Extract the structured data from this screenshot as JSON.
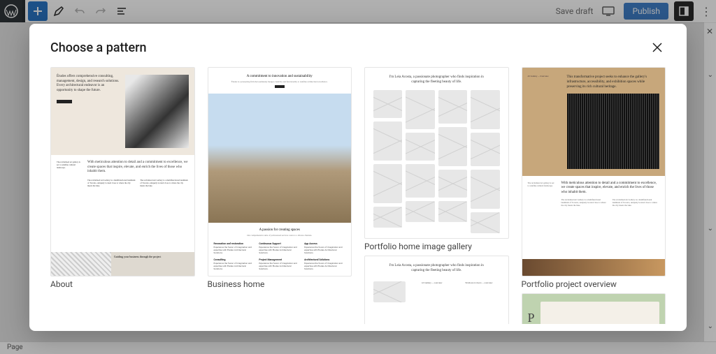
{
  "toolbar": {
    "save_draft": "Save draft",
    "publish": "Publish"
  },
  "footer": {
    "label": "Page"
  },
  "modal": {
    "title": "Choose a pattern"
  },
  "patterns": {
    "about": {
      "label": "About",
      "hero_text": "Études offers comprehensive consulting, management, design, and research solutions. Every architectural endeavor is an opportunity to shape the future.",
      "body_headline": "With meticulous attention to detail and a commitment to excellence, we create spaces that inspire, elevate, and enrich the lives of those who inhabit them.",
      "foot_headline": "Guiding your business through the project"
    },
    "business": {
      "label": "Business home",
      "top_heading": "A commitment to innovation and sustainability",
      "mid_heading": "A passion for creating spaces",
      "grid_items": [
        "Renovation and restoration",
        "Continuous Support",
        "App Access",
        "Consulting",
        "Project Management",
        "Architectural Solutions"
      ]
    },
    "portfolio_gallery": {
      "label": "Portfolio home image gallery",
      "intro": "I'm Leia Acosta, a passionate photographer who finds inspiration in capturing the fleeting beauty of life."
    },
    "project_overview": {
      "label": "Portfolio project overview",
      "hero_text": "This transformative project seeks to enhance the gallery's infrastructure, accessibility, and exhibition spaces while preserving its rich cultural heritage.",
      "body_headline": "With meticulous attention to detail and a commitment to excellence, we create spaces that inspire, elevate, and enrich the lives of those who inhabit them."
    }
  }
}
